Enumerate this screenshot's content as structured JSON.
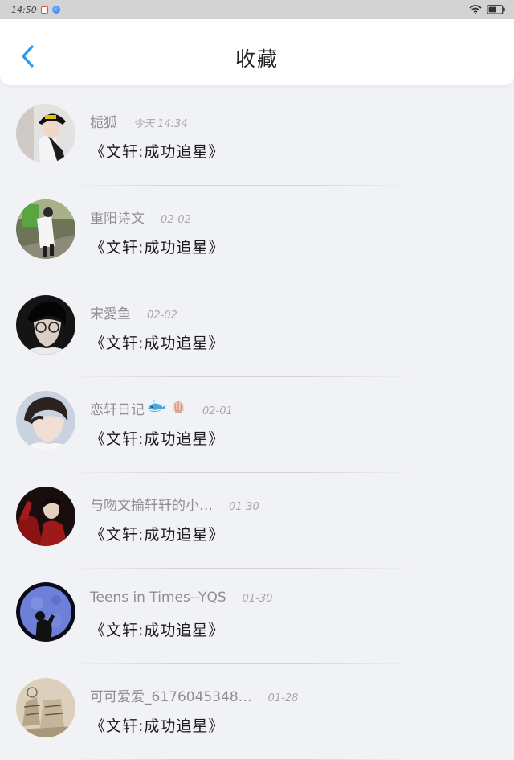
{
  "status_bar": {
    "time": "14:50",
    "accent_red": "#e24b4b",
    "accent_blue": "#2d6fe0"
  },
  "header": {
    "title": "收藏",
    "back_icon": "chevron-left-icon",
    "back_color": "#2a9af0"
  },
  "items": [
    {
      "author": "栀狐",
      "time": "今天 14:34",
      "title": "《文轩:成功追星》",
      "avatar": "avatar-girl-black-hat"
    },
    {
      "author": "重阳诗文",
      "time": "02-02",
      "title": "《文轩:成功追星》",
      "avatar": "avatar-street-photo"
    },
    {
      "author": "宋愛鱼",
      "time": "02-02",
      "title": "《文轩:成功追星》",
      "avatar": "avatar-boy-glasses"
    },
    {
      "author": "恋轩日记",
      "time": "02-01",
      "title": "《文轩:成功追星》",
      "avatar": "avatar-boy-portrait",
      "emojis": [
        "whale",
        "shell"
      ]
    },
    {
      "author": "与吻文掄轩轩的小…",
      "time": "01-30",
      "title": "《文轩:成功追星》",
      "avatar": "avatar-boy-red-shirt"
    },
    {
      "author": "Teens in Times--YQS",
      "time": "01-30",
      "title": "《文轩:成功追星》",
      "avatar": "avatar-moon-silhouette"
    },
    {
      "author": "可可爱爱_6176045348…",
      "time": "01-28",
      "title": "《文轩:成功追星》",
      "avatar": "avatar-sketch"
    }
  ]
}
